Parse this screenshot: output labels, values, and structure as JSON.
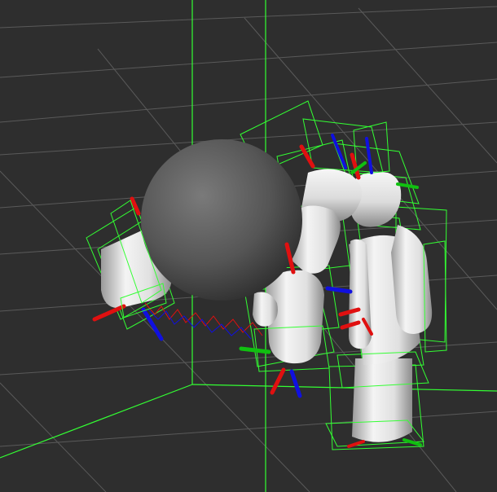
{
  "scene": {
    "background_color": "#2e2e2e",
    "grid_color": "#5a5a5a",
    "bounding_box_color": "#33ff33",
    "axis_colors": {
      "x": "#e01010",
      "y": "#10c010",
      "z": "#1010e0"
    },
    "constraint_spring_colors": [
      "#e01010",
      "#1010e0",
      "#10c010"
    ],
    "objects": [
      {
        "name": "sphere",
        "shape": "sphere",
        "color": "#5c5c5c"
      },
      {
        "name": "ragdoll",
        "shape": "capsule-ragdoll",
        "color": "#e8e8e8"
      },
      {
        "name": "floating-capsule",
        "shape": "capsule",
        "color": "#e8e8e8"
      }
    ]
  }
}
